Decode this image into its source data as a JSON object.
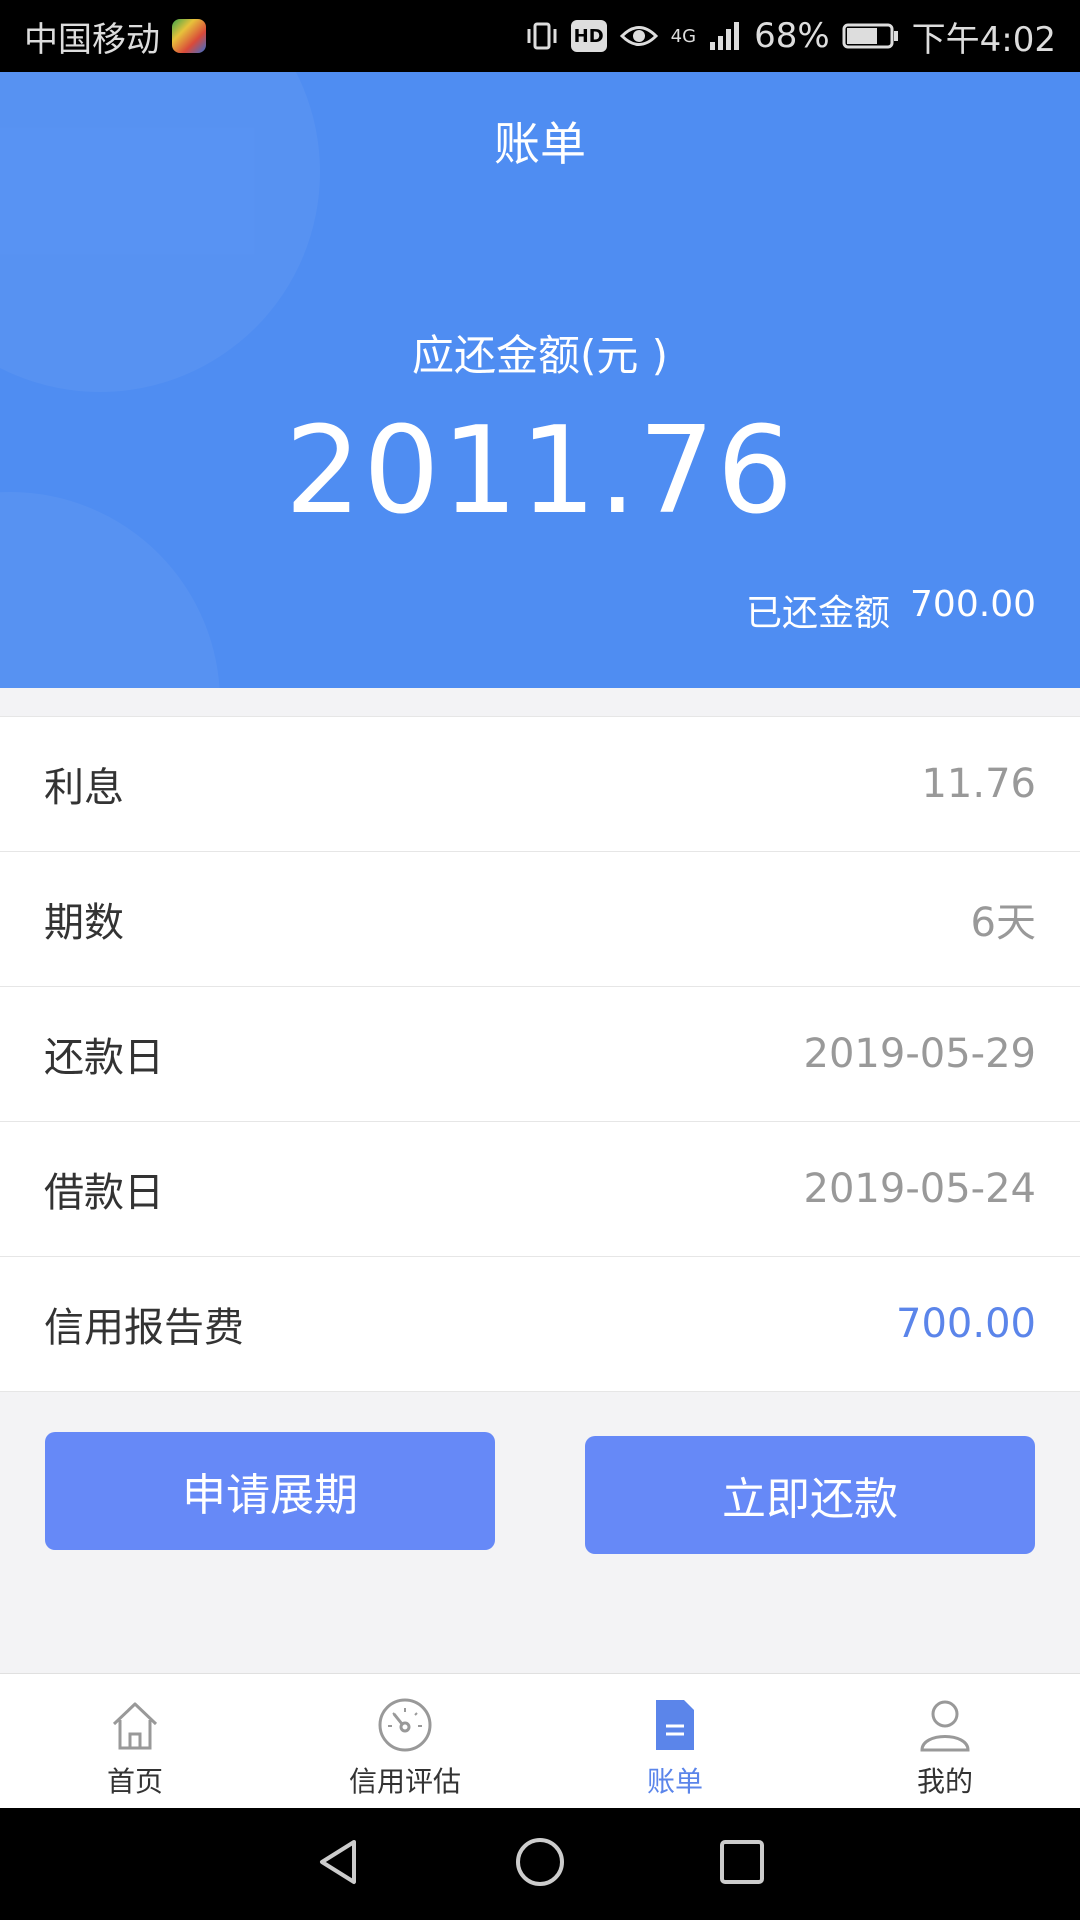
{
  "status_bar": {
    "carrier": "中国移动",
    "network": "4G",
    "battery": "68%",
    "time": "下午4:02",
    "hd_label": "HD"
  },
  "header": {
    "title": "账单",
    "due_label": "应还金额(元 )",
    "due_amount": "2011.76",
    "paid_label": "已还金额",
    "paid_value": "700.00"
  },
  "details": {
    "rows": [
      {
        "label": "利息",
        "value": "11.76"
      },
      {
        "label": "期数",
        "value": "6天"
      },
      {
        "label": "还款日",
        "value": "2019-05-29"
      },
      {
        "label": "借款日",
        "value": "2019-05-24"
      },
      {
        "label": "信用报告费",
        "value": "700.00"
      }
    ]
  },
  "actions": {
    "extend_label": "申请展期",
    "repay_label": "立即还款"
  },
  "bottom_nav": {
    "items": [
      {
        "label": "首页",
        "icon": "home-icon"
      },
      {
        "label": "信用评估",
        "icon": "gauge-icon"
      },
      {
        "label": "账单",
        "icon": "bill-icon",
        "active": true
      },
      {
        "label": "我的",
        "icon": "user-icon"
      }
    ]
  },
  "colors": {
    "header_bg": "#4f8df2",
    "button_bg": "#6689f7",
    "accent": "#5b85ea"
  }
}
